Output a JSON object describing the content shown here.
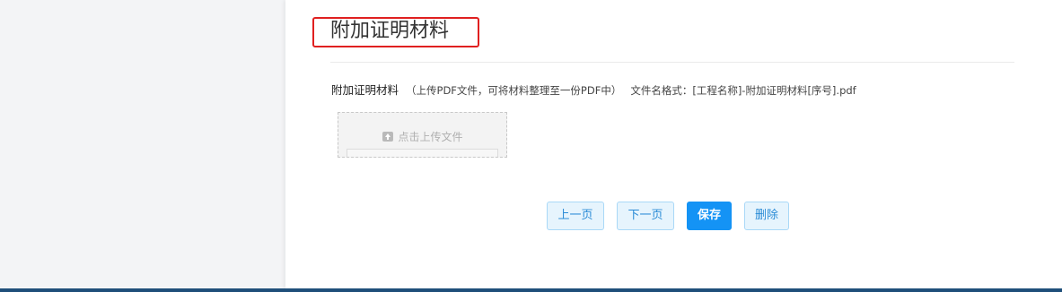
{
  "section": {
    "title": "附加证明材料"
  },
  "field": {
    "label": "附加证明材料",
    "hint": "（上传PDF文件，可将材料整理至一份PDF中）",
    "format": "文件名格式：[工程名称]-附加证明材料[序号].pdf"
  },
  "upload": {
    "button_text": "点击上传文件",
    "icon": "upload-icon"
  },
  "actions": {
    "prev_label": "上一页",
    "next_label": "下一页",
    "save_label": "保存",
    "delete_label": "删除"
  },
  "colors": {
    "primary": "#1493f5",
    "light_button_bg": "#e6f4fd",
    "highlight_border": "#e02020",
    "bottom_bar": "#1f4f7a"
  }
}
